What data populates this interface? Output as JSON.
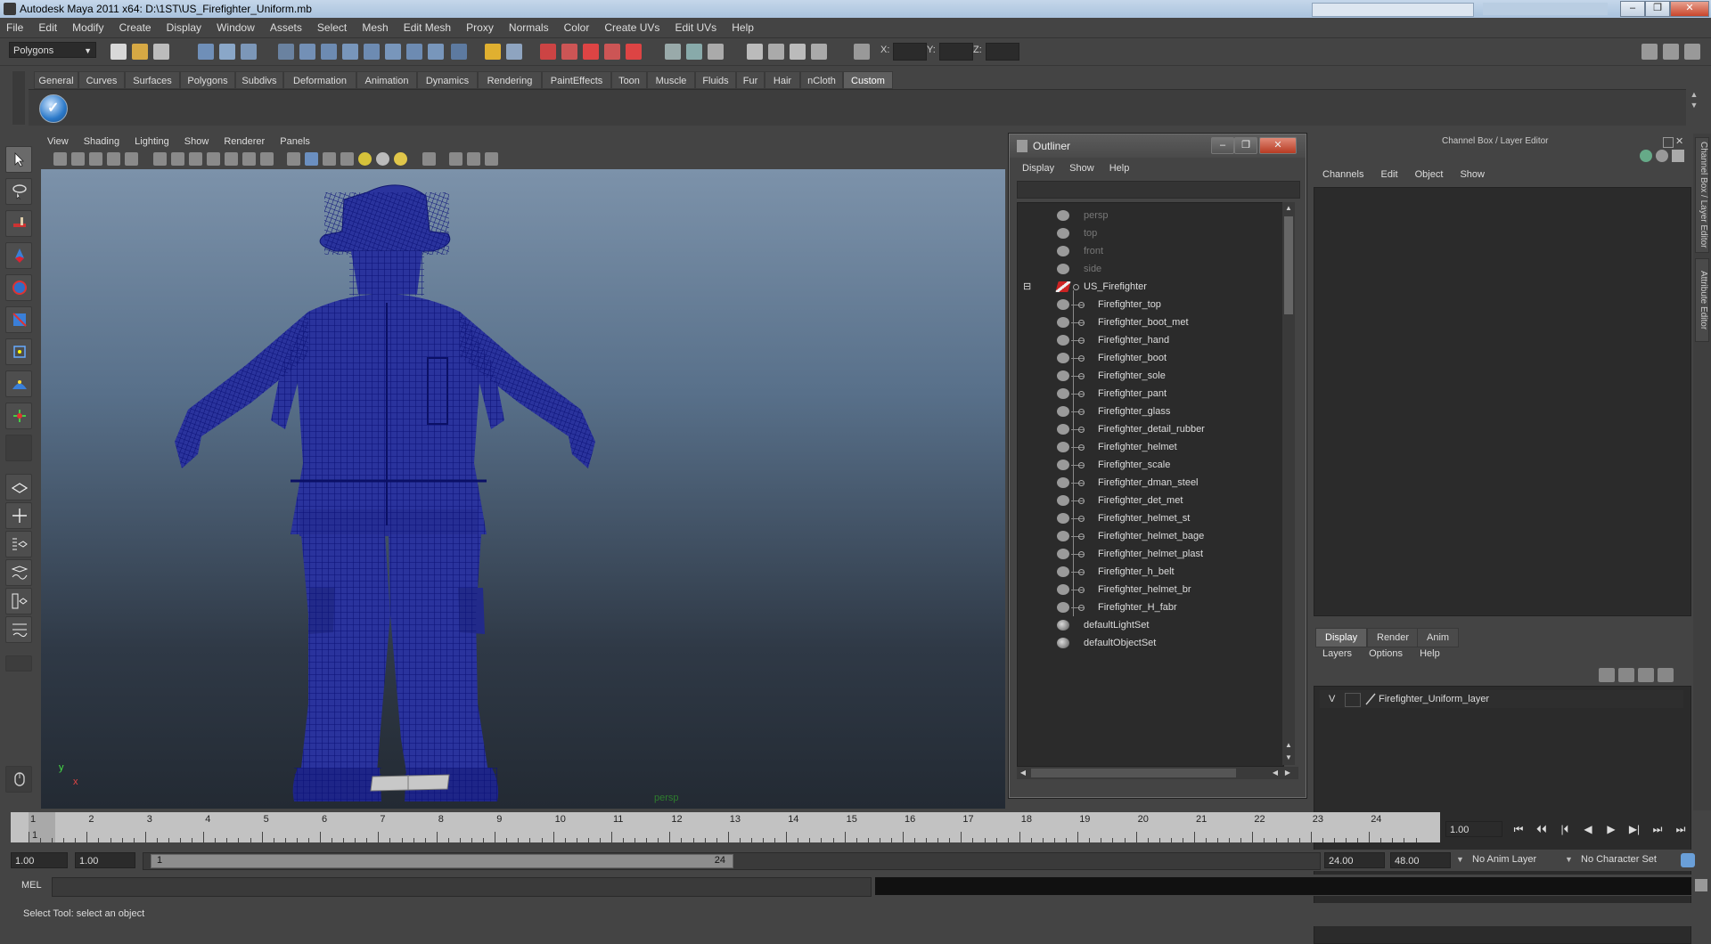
{
  "window": {
    "title": "Autodesk Maya 2011 x64: D:\\1ST\\US_Firefighter_Uniform.mb",
    "controls": [
      "–",
      "❐",
      "✕"
    ]
  },
  "menubar": [
    "File",
    "Edit",
    "Modify",
    "Create",
    "Display",
    "Window",
    "Assets",
    "Select",
    "Mesh",
    "Edit Mesh",
    "Proxy",
    "Normals",
    "Color",
    "Create UVs",
    "Edit UVs",
    "Help"
  ],
  "statusline": {
    "mode": "Polygons",
    "coord_labels": [
      "X:",
      "Y:",
      "Z:"
    ]
  },
  "shelf": {
    "tabs": [
      "General",
      "Curves",
      "Surfaces",
      "Polygons",
      "Subdivs",
      "Deformation",
      "Animation",
      "Dynamics",
      "Rendering",
      "PaintEffects",
      "Toon",
      "Muscle",
      "Fluids",
      "Fur",
      "Hair",
      "nCloth",
      "Custom"
    ],
    "active_tab": "Custom"
  },
  "viewport": {
    "menu": [
      "View",
      "Shading",
      "Lighting",
      "Show",
      "Renderer",
      "Panels"
    ],
    "camera_label": "persp",
    "axis_y": "y",
    "axis_x": "x",
    "wire_color": "#1a1f8c"
  },
  "outliner": {
    "title": "Outliner",
    "menu": [
      "Display",
      "Show",
      "Help"
    ],
    "items": [
      {
        "label": "persp",
        "dim": true,
        "icon": "camera-icon"
      },
      {
        "label": "top",
        "dim": true,
        "icon": "camera-icon"
      },
      {
        "label": "front",
        "dim": true,
        "icon": "camera-icon"
      },
      {
        "label": "side",
        "dim": true,
        "icon": "camera-icon"
      },
      {
        "label": "US_Firefighter",
        "dim": false,
        "icon": "group-icon",
        "collapse": "⊟"
      },
      {
        "label": "Firefighter_top",
        "child": true,
        "icon": "mesh-icon"
      },
      {
        "label": "Firefighter_boot_met",
        "child": true,
        "icon": "mesh-icon"
      },
      {
        "label": "Firefighter_hand",
        "child": true,
        "icon": "mesh-icon"
      },
      {
        "label": "Firefighter_boot",
        "child": true,
        "icon": "mesh-icon"
      },
      {
        "label": "Firefighter_sole",
        "child": true,
        "icon": "mesh-icon"
      },
      {
        "label": "Firefighter_pant",
        "child": true,
        "icon": "mesh-icon"
      },
      {
        "label": "Firefighter_glass",
        "child": true,
        "icon": "mesh-icon"
      },
      {
        "label": "Firefighter_detail_rubber",
        "child": true,
        "icon": "mesh-icon"
      },
      {
        "label": "Firefighter_helmet",
        "child": true,
        "icon": "mesh-icon"
      },
      {
        "label": "Firefighter_scale",
        "child": true,
        "icon": "mesh-icon"
      },
      {
        "label": "Firefighter_dman_steel",
        "child": true,
        "icon": "mesh-icon"
      },
      {
        "label": "Firefighter_det_met",
        "child": true,
        "icon": "mesh-icon"
      },
      {
        "label": "Firefighter_helmet_st",
        "child": true,
        "icon": "mesh-icon"
      },
      {
        "label": "Firefighter_helmet_bage",
        "child": true,
        "icon": "mesh-icon"
      },
      {
        "label": "Firefighter_helmet_plast",
        "child": true,
        "icon": "mesh-icon"
      },
      {
        "label": "Firefighter_h_belt",
        "child": true,
        "icon": "mesh-icon"
      },
      {
        "label": "Firefighter_helmet_br",
        "child": true,
        "icon": "mesh-icon"
      },
      {
        "label": "Firefighter_H_fabr",
        "child": true,
        "icon": "mesh-icon"
      },
      {
        "label": "defaultLightSet",
        "icon": "set-icon"
      },
      {
        "label": "defaultObjectSet",
        "icon": "set-icon"
      }
    ]
  },
  "channelbox": {
    "title": "Channel Box / Layer Editor",
    "menu": [
      "Channels",
      "Edit",
      "Object",
      "Show"
    ],
    "layer_tabs": [
      "Display",
      "Render",
      "Anim"
    ],
    "active_layer_tab": "Display",
    "layer_menu": [
      "Layers",
      "Options",
      "Help"
    ],
    "layer": {
      "visible": "V",
      "name": "Firefighter_Uniform_layer"
    },
    "side_tabs": [
      "Channel Box / Layer Editor",
      "Attribute Editor"
    ]
  },
  "timeslider": {
    "ticks": [
      "1",
      "2",
      "3",
      "4",
      "5",
      "6",
      "7",
      "8",
      "9",
      "10",
      "11",
      "12",
      "13",
      "14",
      "15",
      "16",
      "17",
      "18",
      "19",
      "20",
      "21",
      "22",
      "23",
      "24"
    ],
    "current_frame": "1",
    "current_time_field": "1.00",
    "playback_buttons": [
      "⏮",
      "⏴⏴",
      "|⏴",
      "◀",
      "▶",
      "▶|",
      "⏭",
      "⏭"
    ]
  },
  "range": {
    "start_time": "1.00",
    "playback_start": "1.00",
    "thumb_start": "1",
    "thumb_end": "24",
    "playback_end": "24.00",
    "end_time": "48.00",
    "anim_layer": "No Anim Layer",
    "character_set": "No Character Set"
  },
  "command": {
    "label": "MEL"
  },
  "helpline": "Select Tool: select an object"
}
